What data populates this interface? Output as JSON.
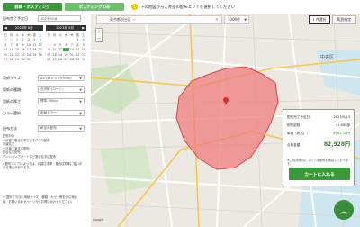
{
  "tabs": [
    {
      "label": "詳細・ポスティング"
    },
    {
      "label": "ポスティングのみ"
    }
  ],
  "notice": {
    "text": "下の地図からご希望の配布エリアを選択してください"
  },
  "left": {
    "start_date_label": "配布完了予定日",
    "start_date_value": "2023/9/18",
    "cal1": {
      "title": "2023年 8月",
      "days": [
        " ",
        "  ",
        "1",
        "2",
        "3",
        "4",
        "5",
        "6",
        "7",
        "8",
        "9",
        "10",
        "11",
        "12",
        "13",
        "14",
        "15",
        "16",
        "17",
        "18",
        "19",
        "20",
        "21",
        "22",
        "23",
        "24",
        "25",
        "26",
        "27",
        "28",
        "29",
        "30",
        "31"
      ]
    },
    "cal2": {
      "title": "2023年 9月"
    },
    "size_label": "用紙サイズ",
    "size_value": "A4 (210 × 297mm)",
    "type_label": "用紙の種類",
    "type_value": "光沢紙 (コート)",
    "thickness_label": "用紙の厚さ",
    "thickness_value": "標準 (90kg)",
    "color_label": "カラー選択",
    "color_value": "両面カラー",
    "method_label": "配布方法",
    "method_value": "軒並み配布",
    "notes": [
      "配布対象",
      "一戸建て集合住宅などすべての配布",
      "戸建住宅",
      "一戸建て家住に配布",
      "集合住宅配布",
      "マンションアパートなど集合住宅に配布",
      "※配布エリアによっては、戸建住宅率・集合住宅率に違いが",
      "ある場合があります。",
      "",
      "※ 選択できない用紙サイズ・種類・カラー等を含む場合",
      "は、お問い合わせページからお問い合わせください。"
    ]
  },
  "map": {
    "search_value": "東京都渋谷区 一",
    "range_value": "1000件",
    "btn_select": "1 件選択",
    "btn_clear": "範囲指定",
    "zoom_in": "+",
    "zoom_out": "−",
    "area_label": "中央区",
    "footer": "Google"
  },
  "card": {
    "date_label": "配布完了予定日：",
    "date_value": "2023/9/13",
    "count_label": "配布部数：",
    "count_value": "11,660部",
    "unit_label": "単価（税込）：",
    "unit_value": "約 ¥7.10円",
    "total_label": "合計金額：",
    "total_value": "82,928円",
    "hint": "※ご利用条件について詳細等を確認しております。",
    "cart_label": "カートに入れる"
  },
  "colors": {
    "accent": "#3a9a3a",
    "area_fill": "#ef7d7d",
    "area_border": "#d94747"
  }
}
